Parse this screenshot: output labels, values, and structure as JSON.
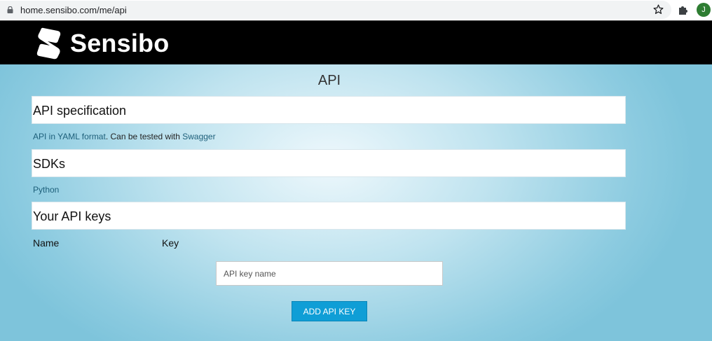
{
  "browser": {
    "url": "home.sensibo.com/me/api",
    "avatar_initial": "J"
  },
  "header": {
    "logo_text": "Sensibo"
  },
  "page": {
    "title": "API",
    "sections": [
      {
        "heading": "API specification"
      },
      {
        "heading": "SDKs"
      },
      {
        "heading": "Your API keys"
      }
    ],
    "spec_desc": {
      "link1": "API in YAML format",
      "mid_text": ". Can be tested with ",
      "link2": "Swagger"
    },
    "sdk_link": "Python",
    "keys_table": {
      "col_name": "Name",
      "col_key": "Key"
    },
    "key_input": {
      "placeholder": "API key name",
      "value": ""
    },
    "add_button": "ADD API KEY"
  },
  "colors": {
    "header_bg": "#000000",
    "button": "#0f9ed6",
    "link": "#1d5f7a",
    "avatar": "#2e7d32"
  }
}
